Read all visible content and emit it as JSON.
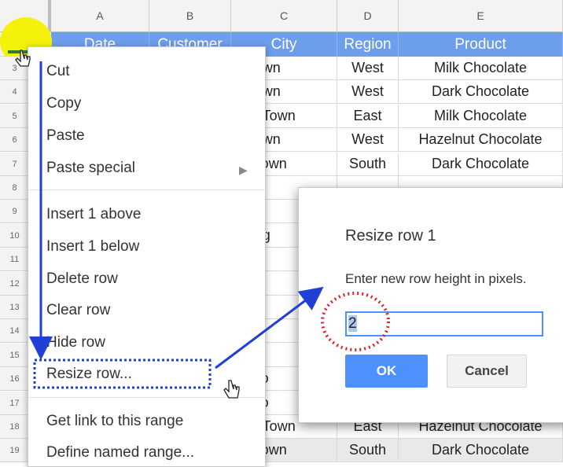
{
  "columns": [
    "A",
    "B",
    "C",
    "D",
    "E"
  ],
  "header_row": {
    "row_number": "1",
    "cells": [
      "Date",
      "Customer",
      "City",
      "Region",
      "Product"
    ]
  },
  "rows": [
    {
      "num": "3",
      "city": "g Town",
      "region": "West",
      "product": "Milk Chocolate"
    },
    {
      "num": "4",
      "city": "g Town",
      "region": "West",
      "product": "Dark Chocolate"
    },
    {
      "num": "5",
      "city": "ium Town",
      "region": "East",
      "product": "Milk Chocolate"
    },
    {
      "num": "6",
      "city": "g Town",
      "region": "West",
      "product": "Hazelnut Chocolate"
    },
    {
      "num": "7",
      "city": "all Town",
      "region": "South",
      "product": "Dark Chocolate"
    },
    {
      "num": "8",
      "city": "g To",
      "region": "",
      "product": ""
    },
    {
      "num": "9",
      "city": "g To",
      "region": "",
      "product": ""
    },
    {
      "num": "10",
      "city": "Villag",
      "region": "",
      "product": ""
    },
    {
      "num": "11",
      "city": "ium",
      "region": "",
      "product": ""
    },
    {
      "num": "12",
      "city": "ium",
      "region": "",
      "product": ""
    },
    {
      "num": "13",
      "city": "ium",
      "region": "",
      "product": ""
    },
    {
      "num": "14",
      "city": "ium",
      "region": "",
      "product": ""
    },
    {
      "num": "15",
      "city": "ium",
      "region": "",
      "product": ""
    },
    {
      "num": "16",
      "city": "all To",
      "region": "",
      "product": ""
    },
    {
      "num": "17",
      "city": "all To",
      "region": "",
      "product": ""
    },
    {
      "num": "18",
      "city": "ium Town",
      "region": "East",
      "product": "Hazelnut Chocolate"
    },
    {
      "num": "19",
      "city": "all Town",
      "region": "South",
      "product": "Dark Chocolate"
    }
  ],
  "context_menu": {
    "cut": "Cut",
    "copy": "Copy",
    "paste": "Paste",
    "paste_special": "Paste special",
    "insert_above": "Insert 1 above",
    "insert_below": "Insert 1 below",
    "delete_row": "Delete row",
    "clear_row": "Clear row",
    "hide_row": "Hide row",
    "resize_row": "Resize row...",
    "get_link": "Get link to this range",
    "define_named_range": "Define named range..."
  },
  "dialog": {
    "title": "Resize row 1",
    "prompt": "Enter new row height in pixels.",
    "value": "2",
    "ok": "OK",
    "cancel": "Cancel"
  },
  "colors": {
    "header_fill": "#6d9eeb",
    "highlight": "#f4f20a",
    "annotation_blue": "#1f3fd6",
    "annotation_red": "#d9232a",
    "ok_button": "#4d90fe"
  }
}
